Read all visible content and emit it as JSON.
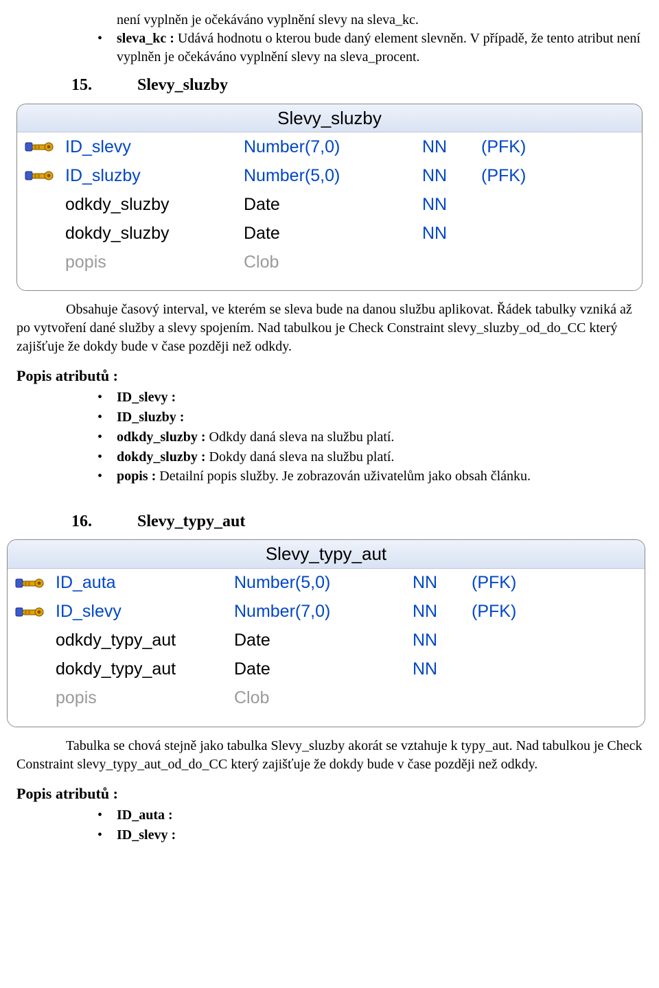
{
  "intro": {
    "line1": "není vyplněn je očekáváno vyplnění slevy na sleva_kc.",
    "bullet_bold": "sleva_kc :",
    "bullet_rest": " Udává hodnotu o kterou bude daný element slevněn. V případě, že tento atribut není vyplněn je očekáváno vyplnění slevy na sleva_procent."
  },
  "section15": {
    "num": "15.",
    "title": "Slevy_sluzby",
    "table": {
      "caption": "Slevy_sluzby",
      "rows": [
        {
          "key": true,
          "name": "ID_slevy",
          "type": "Number(7,0)",
          "nn": "NN",
          "tag": "(PFK)",
          "style": "blue"
        },
        {
          "key": true,
          "name": "ID_sluzby",
          "type": "Number(5,0)",
          "nn": "NN",
          "tag": "(PFK)",
          "style": "blue"
        },
        {
          "key": false,
          "name": "odkdy_sluzby",
          "type": "Date",
          "nn": "NN",
          "tag": "",
          "style": "black"
        },
        {
          "key": false,
          "name": "dokdy_sluzby",
          "type": "Date",
          "nn": "NN",
          "tag": "",
          "style": "black"
        },
        {
          "key": false,
          "name": "popis",
          "type": "Clob",
          "nn": "",
          "tag": "",
          "style": "gray"
        }
      ]
    },
    "para": "Obsahuje časový interval, ve kterém se sleva bude na danou službu aplikovat. Řádek tabulky vzniká až po vytvoření dané služby a slevy spojením. Nad tabulkou je Check Constraint slevy_sluzby_od_do_CC který zajišťuje že dokdy bude v čase později než odkdy.",
    "popis_title": "Popis atributů :",
    "attrs": [
      {
        "b": "ID_slevy :",
        "r": ""
      },
      {
        "b": "ID_sluzby :",
        "r": ""
      },
      {
        "b": "odkdy_sluzby :",
        "r": " Odkdy daná sleva na službu platí."
      },
      {
        "b": "dokdy_sluzby :",
        "r": " Dokdy daná sleva na službu platí."
      },
      {
        "b": "popis :",
        "r": " Detailní popis služby. Je zobrazován uživatelům jako obsah článku."
      }
    ]
  },
  "section16": {
    "num": "16.",
    "title": "Slevy_typy_aut",
    "table": {
      "caption": "Slevy_typy_aut",
      "rows": [
        {
          "key": true,
          "name": "ID_auta",
          "type": "Number(5,0)",
          "nn": "NN",
          "tag": "(PFK)",
          "style": "blue"
        },
        {
          "key": true,
          "name": "ID_slevy",
          "type": "Number(7,0)",
          "nn": "NN",
          "tag": "(PFK)",
          "style": "blue"
        },
        {
          "key": false,
          "name": "odkdy_typy_aut",
          "type": "Date",
          "nn": "NN",
          "tag": "",
          "style": "black"
        },
        {
          "key": false,
          "name": "dokdy_typy_aut",
          "type": "Date",
          "nn": "NN",
          "tag": "",
          "style": "black"
        },
        {
          "key": false,
          "name": "popis",
          "type": "Clob",
          "nn": "",
          "tag": "",
          "style": "gray"
        }
      ]
    },
    "para": "Tabulka se chová stejně jako tabulka Slevy_sluzby akorát se vztahuje k typy_aut. Nad tabulkou je Check Constraint slevy_typy_aut_od_do_CC který zajišťuje že dokdy bude v čase později než odkdy.",
    "popis_title": "Popis atributů :",
    "attrs": [
      {
        "b": "ID_auta :",
        "r": ""
      },
      {
        "b": "ID_slevy :",
        "r": ""
      }
    ]
  }
}
